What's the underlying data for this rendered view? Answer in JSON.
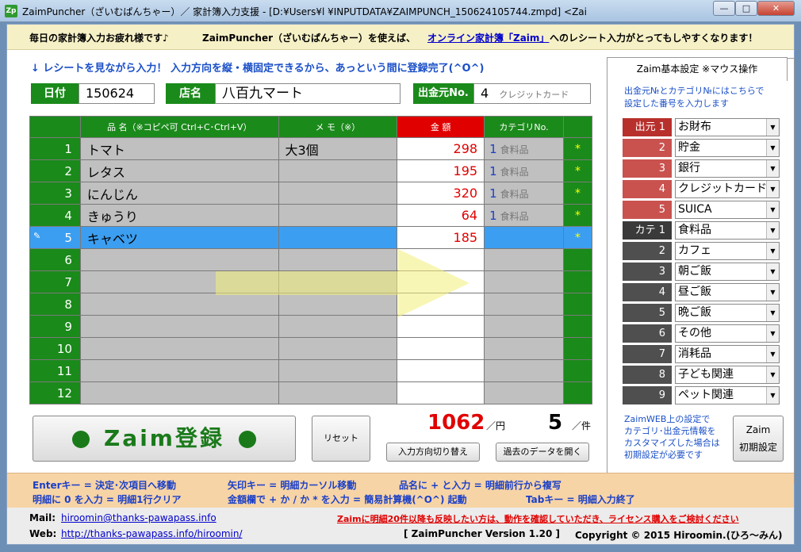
{
  "window": {
    "icon": "Zp",
    "title": "ZaimPuncher（ざいむぱんちゃー）／ 家計簿入力支援 - [D:¥Users¥l                              ¥INPUTDATA¥ZAIMPUNCH_150624105744.zmpd]  <Zai",
    "min": "—",
    "max": "□",
    "close": "✕"
  },
  "banner": {
    "greeting": "毎日の家計簿入力お疲れ様です♪",
    "prefix": "ZaimPuncher（ざいむぱんちゃー）を使えば、",
    "link": "オンライン家計簿「Zaim」",
    "suffix": "へのレシート入力がとってもしやすくなります！"
  },
  "hint": "↓ レシートを見ながら入力！ 入力方向を縦・横固定できるから、あっという間に登録完了(^O^)",
  "header": {
    "date_label": "日付",
    "date_value": "150624",
    "shop_label": "店名",
    "shop_value": "八百九マート",
    "source_label": "出金元No.",
    "source_no": "4",
    "source_name": "クレジットカード"
  },
  "grid": {
    "columns": [
      "",
      "品 名（※コピペ可 Ctrl+C･Ctrl+V）",
      "メ モ（※）",
      "金 額",
      "カテゴリNo.",
      ""
    ],
    "rows": [
      {
        "no": "1",
        "name": "トマト",
        "memo": "大3個",
        "amount": "298",
        "cat_no": "1",
        "cat_name": "食料品",
        "mark": "*"
      },
      {
        "no": "2",
        "name": "レタス",
        "memo": "",
        "amount": "195",
        "cat_no": "1",
        "cat_name": "食料品",
        "mark": "*"
      },
      {
        "no": "3",
        "name": "にんじん",
        "memo": "",
        "amount": "320",
        "cat_no": "1",
        "cat_name": "食料品",
        "mark": "*"
      },
      {
        "no": "4",
        "name": "きゅうり",
        "memo": "",
        "amount": "64",
        "cat_no": "1",
        "cat_name": "食料品",
        "mark": "*"
      },
      {
        "no": "5",
        "name": "キャベツ",
        "memo": "",
        "amount": "185",
        "cat_no": "",
        "cat_name": "",
        "mark": "*",
        "selected": true
      },
      {
        "no": "6",
        "name": "",
        "memo": "",
        "amount": "",
        "cat_no": "",
        "cat_name": "",
        "mark": ""
      },
      {
        "no": "7",
        "name": "",
        "memo": "",
        "amount": "",
        "cat_no": "",
        "cat_name": "",
        "mark": ""
      },
      {
        "no": "8",
        "name": "",
        "memo": "",
        "amount": "",
        "cat_no": "",
        "cat_name": "",
        "mark": ""
      },
      {
        "no": "9",
        "name": "",
        "memo": "",
        "amount": "",
        "cat_no": "",
        "cat_name": "",
        "mark": ""
      },
      {
        "no": "10",
        "name": "",
        "memo": "",
        "amount": "",
        "cat_no": "",
        "cat_name": "",
        "mark": ""
      },
      {
        "no": "11",
        "name": "",
        "memo": "",
        "amount": "",
        "cat_no": "",
        "cat_name": "",
        "mark": ""
      },
      {
        "no": "12",
        "name": "",
        "memo": "",
        "amount": "",
        "cat_no": "",
        "cat_name": "",
        "mark": ""
      }
    ],
    "edit_icon": "pencil-icon"
  },
  "actions": {
    "register": "Zaim登録",
    "reset": "リセット",
    "direction": "入力方向切り替え",
    "history": "過去のデータを開く",
    "total": "1062",
    "total_unit": "／円",
    "count": "5",
    "count_unit": "／件"
  },
  "panel": {
    "tab": "Zaim基本設定 ※マウス操作",
    "desc1": "出金元№とカテゴリ№にはこちらで",
    "desc2": "設定した番号を入力します",
    "sources": [
      {
        "label": "出元 1",
        "value": "お財布"
      },
      {
        "label": "2",
        "value": "貯金"
      },
      {
        "label": "3",
        "value": "銀行"
      },
      {
        "label": "4",
        "value": "クレジットカード"
      },
      {
        "label": "5",
        "value": "SUICA"
      }
    ],
    "categories": [
      {
        "label": "カテ 1",
        "value": "食料品"
      },
      {
        "label": "2",
        "value": "カフェ"
      },
      {
        "label": "3",
        "value": "朝ご飯"
      },
      {
        "label": "4",
        "value": "昼ご飯"
      },
      {
        "label": "5",
        "value": "晩ご飯"
      },
      {
        "label": "6",
        "value": "その他"
      },
      {
        "label": "7",
        "value": "消耗品"
      },
      {
        "label": "8",
        "value": "子ども関連"
      },
      {
        "label": "9",
        "value": "ペット関連"
      }
    ],
    "dropdown_icon": "▼",
    "note1": "ZaimWEB上の設定で",
    "note2": "カテゴリ･出金元情報を",
    "note3": "カスタマイズした場合は",
    "note4": "初期設定が必要です",
    "init_btn1": "Zaim",
    "init_btn2": "初期設定"
  },
  "help": {
    "h1": "Enterキー = 決定･次項目へ移動",
    "h2": "矢印キー = 明細カーソル移動",
    "h3": "品名に + と入力 = 明細前行から複写",
    "h4": "明細に 0 を入力 = 明細1行クリア",
    "h5": "金額欄で + か / か * を入力 = 簡易計算機(^O^) 起動",
    "h6": "Tabキー = 明細入力終了"
  },
  "footer": {
    "mail_label": "Mail:",
    "mail": "hiroomin@thanks-pawapass.info",
    "web_label": "Web:",
    "web": "http://thanks-pawapass.info/hiroomin/",
    "notice": "Zaimに明細20件以降も反映したい方は、動作を確認していただき、ライセンス購入をご検討ください",
    "version": "[ ZaimPuncher Version 1.20 ]",
    "copyright": "Copyright © 2015 Hiroomin.(ひろ～みん)"
  },
  "colors": {
    "accent_green": "#1a8a1a",
    "amount_red": "#e00000",
    "selected_blue": "#3c9ef0",
    "banner": "#f6f0c6",
    "help_bar": "#f7d4a6"
  }
}
